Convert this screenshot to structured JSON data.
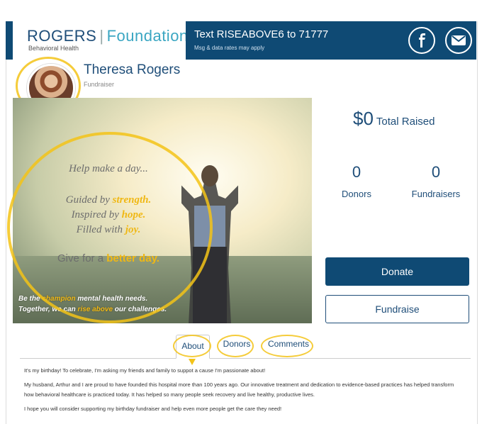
{
  "header": {
    "logo_main": "ROGERS",
    "logo_separator": "|",
    "logo_foundation": "Foundation",
    "logo_sub": "Behavioral Health",
    "text_cta": "Text RISEABOVE6 to 71777",
    "text_sub": "Msg & data rates may apply",
    "facebook_icon": "facebook-icon",
    "mail_icon": "mail-icon"
  },
  "profile": {
    "name": "Theresa Rogers",
    "role": "Fundraiser"
  },
  "hero": {
    "line1": "Help make a day...",
    "line2a": "Guided by ",
    "line2a_gold": "strength.",
    "line2b": "Inspired by ",
    "line2b_gold": "hope.",
    "line2c": "Filled with ",
    "line2c_gold": "joy.",
    "line3": "Give for a ",
    "line3_gold": "better day.",
    "foot1a": "Be the ",
    "foot1_gold": "champion",
    "foot1b": " mental health needs.",
    "foot2a": "Together, we can ",
    "foot2_gold": "rise above",
    "foot2b": " our challenges."
  },
  "stats": {
    "total_amount": "$0",
    "total_label": "Total Raised",
    "donors_count": "0",
    "donors_label": "Donors",
    "fundraisers_count": "0",
    "fundraisers_label": "Fundraisers"
  },
  "actions": {
    "donate_label": "Donate",
    "fundraise_label": "Fundraise"
  },
  "tabs": [
    {
      "label": "About"
    },
    {
      "label": "Donors"
    },
    {
      "label": "Comments"
    }
  ],
  "about": {
    "p1": "It's my birthday! To celebrate, I'm asking my friends and family to suppot a cause I'm passionate about!",
    "p2": "My husband, Arthur and I are proud to have founded this hospital more than 100 years ago. Our innovative treatment and dedication to evidence-based practices has helped transform how behavioral healthcare is practiced today. It has helped so many people seek recovery and live healthy, productive lives.",
    "p3": "I hope you will consider supporting my birthday fundraiser and help even more people get the care they need!"
  },
  "colors": {
    "brand_navy": "#0f4a74",
    "accent_gold": "#f3c318",
    "teal": "#3aa6c2"
  }
}
